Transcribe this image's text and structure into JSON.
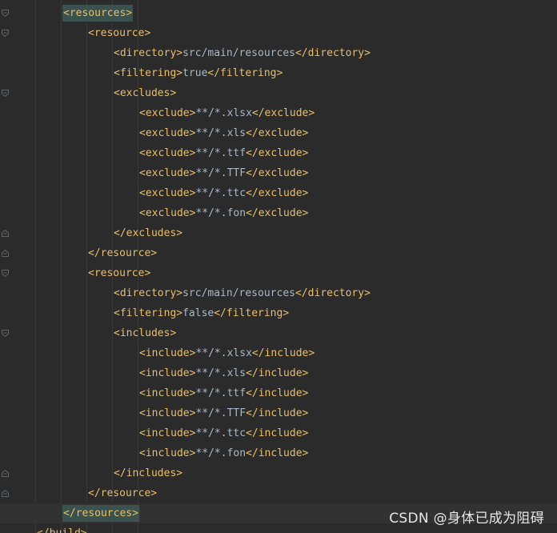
{
  "lines": [
    {
      "open": "<resources>",
      "text": "",
      "close": "",
      "match": true
    },
    {
      "open": "<resource>",
      "text": "",
      "close": ""
    },
    {
      "open": "<directory>",
      "text": "src/main/resources",
      "close": "</directory>"
    },
    {
      "open": "<filtering>",
      "text": "true",
      "close": "</filtering>"
    },
    {
      "open": "<excludes>",
      "text": "",
      "close": ""
    },
    {
      "open": "<exclude>",
      "text": "**/*.xlsx",
      "close": "</exclude>"
    },
    {
      "open": "<exclude>",
      "text": "**/*.xls",
      "close": "</exclude>"
    },
    {
      "open": "<exclude>",
      "text": "**/*.ttf",
      "close": "</exclude>"
    },
    {
      "open": "<exclude>",
      "text": "**/*.TTF",
      "close": "</exclude>"
    },
    {
      "open": "<exclude>",
      "text": "**/*.ttc",
      "close": "</exclude>"
    },
    {
      "open": "<exclude>",
      "text": "**/*.fon",
      "close": "</exclude>"
    },
    {
      "open": "</excludes>",
      "text": "",
      "close": ""
    },
    {
      "open": "</resource>",
      "text": "",
      "close": ""
    },
    {
      "open": "<resource>",
      "text": "",
      "close": ""
    },
    {
      "open": "<directory>",
      "text": "src/main/resources",
      "close": "</directory>"
    },
    {
      "open": "<filtering>",
      "text": "false",
      "close": "</filtering>"
    },
    {
      "open": "<includes>",
      "text": "",
      "close": ""
    },
    {
      "open": "<include>",
      "text": "**/*.xlsx",
      "close": "</include>"
    },
    {
      "open": "<include>",
      "text": "**/*.xls",
      "close": "</include>"
    },
    {
      "open": "<include>",
      "text": "**/*.ttf",
      "close": "</include>"
    },
    {
      "open": "<include>",
      "text": "**/*.TTF",
      "close": "</include>"
    },
    {
      "open": "<include>",
      "text": "**/*.ttc",
      "close": "</include>"
    },
    {
      "open": "<include>",
      "text": "**/*.fon",
      "close": "</include>"
    },
    {
      "open": "</includes>",
      "text": "",
      "close": ""
    },
    {
      "open": "</resource>",
      "text": "",
      "close": ""
    },
    {
      "open": "</resources>",
      "text": "",
      "close": "",
      "match": true,
      "current": true
    },
    {
      "open": "</build>",
      "text": "",
      "close": ""
    }
  ],
  "watermark": "CSDN @身体已成为阻碍",
  "colors": {
    "background": "#2b2b2b",
    "tag": "#e8bf6a",
    "text": "#a9b7c6",
    "tag_match_highlight": "#3b514d",
    "current_line": "#323232"
  },
  "icons": {
    "fold_open": "fold-open-icon",
    "fold_close": "fold-close-icon"
  }
}
